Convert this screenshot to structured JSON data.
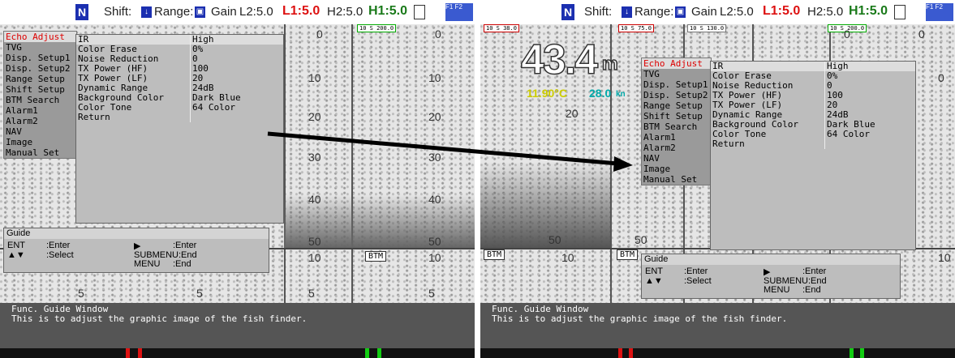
{
  "topbar": {
    "n": "N",
    "shift": "Shift:",
    "shift_icon": "↓",
    "range": "Range:",
    "range_icon": "▣",
    "gain": "Gain",
    "l2": "L2:5.0",
    "l1": "L1:5.0",
    "h2": "H2:5.0",
    "h1": "H1:5.0",
    "fkey": "F1 F2"
  },
  "menu": {
    "items": [
      "Echo Adjust",
      "TVG",
      "Disp. Setup1",
      "Disp. Setup2",
      "Range Setup",
      "Shift Setup",
      "BTM Search",
      "Alarm1",
      "Alarm2",
      "NAV",
      "Image",
      "Manual Set"
    ]
  },
  "settings": {
    "rows": [
      {
        "k": "IR",
        "v": "High"
      },
      {
        "k": "Color Erase",
        "v": "0%"
      },
      {
        "k": "Noise Reduction",
        "v": "0"
      },
      {
        "k": "TX Power (HF)",
        "v": "100"
      },
      {
        "k": "TX Power (LF)",
        "v": "20"
      },
      {
        "k": "Dynamic Range",
        "v": "24dB"
      },
      {
        "k": "Background Color",
        "v": "Dark Blue"
      },
      {
        "k": "Color Tone",
        "v": "64 Color"
      },
      {
        "k": "Return",
        "v": ""
      }
    ]
  },
  "guide": {
    "title": "Guide",
    "ent": "ENT",
    "enter": ":Enter",
    "updown": "▲▼",
    "select": ":Select",
    "play": "▶",
    "enter2": ":Enter",
    "submenu": "SUBMENU:End",
    "menu_key": "MENU",
    "end": ":End"
  },
  "funcwin": {
    "title": "Func. Guide Window",
    "text": "This is to adjust the graphic image of the fish finder."
  },
  "left": {
    "scale_top": "0",
    "ticks": [
      "10",
      "20",
      "30",
      "40",
      "50",
      "10",
      "5"
    ],
    "scale_mid_a": "10",
    "scale_mid_b": "20",
    "scale_mid_c": "30",
    "scale_mid_d": "40",
    "scale_bot": "50",
    "five": "5",
    "box1": "10 S 200.0",
    "btm": "BTM"
  },
  "right": {
    "depth": "43.4",
    "depth_unit": "m",
    "temp": "11.90°C",
    "speed": "28.0",
    "speed_unit": "kn",
    "box1": "10 S 38.0",
    "box2": "10 S 75.0",
    "box3": "10 S 130.0",
    "box4": "10 S 200.0",
    "twenty": "20",
    "fifty": "50",
    "zero": "0",
    "ten": "10",
    "btm": "BTM",
    "btm2": "BTM"
  },
  "colors": {
    "accent_red": "#d11111",
    "accent_green": "#1a7a1a",
    "shift_blue": "#1b2fb0"
  }
}
